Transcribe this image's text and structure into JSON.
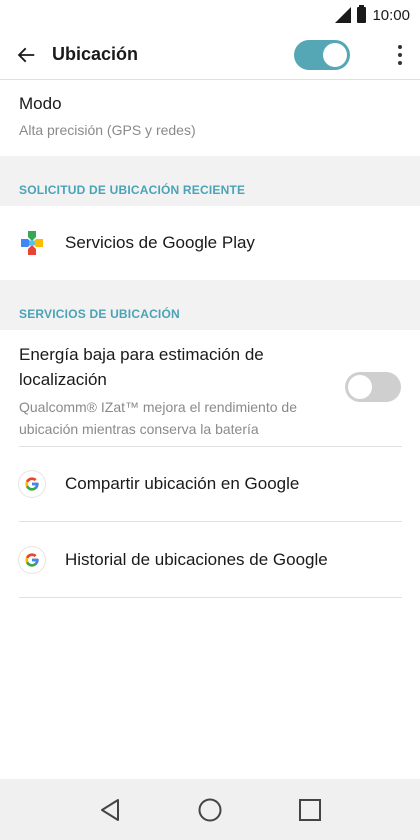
{
  "status_bar": {
    "time": "10:00"
  },
  "app_bar": {
    "title": "Ubicación",
    "location_enabled": true
  },
  "mode": {
    "label": "Modo",
    "value": "Alta precisión (GPS y redes)"
  },
  "recent_requests": {
    "header": "SOLICITUD DE UBICACIÓN RECIENTE",
    "items": [
      {
        "label": "Servicios de Google Play",
        "icon": "google-play-services-icon"
      }
    ]
  },
  "location_services": {
    "header": "SERVICIOS DE UBICACIÓN",
    "low_power": {
      "title": "Energía baja para estimación de localización",
      "description": "Qualcomm® IZat™ mejora el rendimiento de ubicación mientras conserva la batería",
      "enabled": false
    },
    "items": [
      {
        "label": "Compartir ubicación en Google",
        "icon": "google-g-icon"
      },
      {
        "label": "Historial de ubicaciones de Google",
        "icon": "google-g-icon"
      }
    ]
  },
  "colors": {
    "accent": "#4aa3b6",
    "toggle_on": "#56a7b6",
    "toggle_off": "#cfcfcf",
    "secondary_text": "#8a8a8a"
  }
}
